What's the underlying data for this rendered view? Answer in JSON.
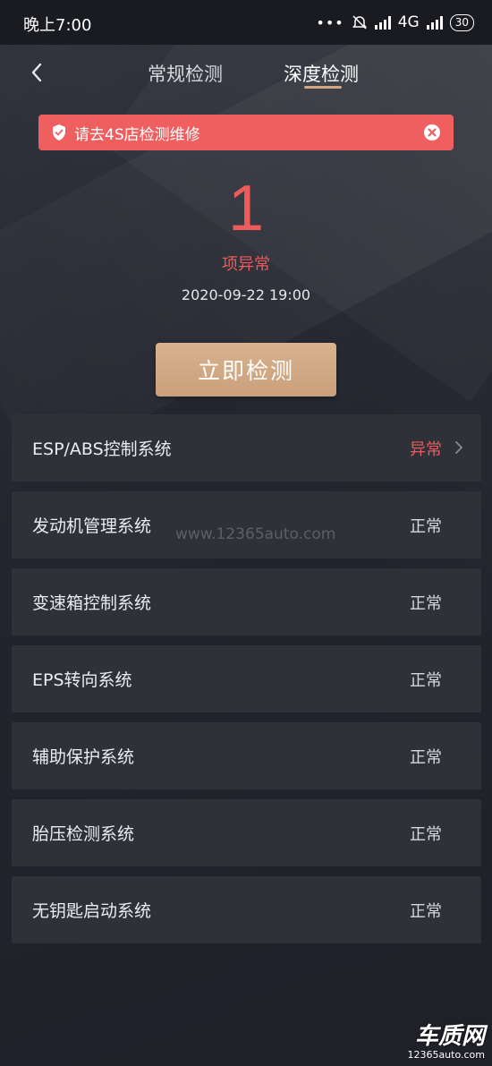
{
  "status_bar": {
    "time": "晚上7:00",
    "network": "4G",
    "battery": "30",
    "dots": "•••"
  },
  "header": {
    "tabs": [
      {
        "label": "常规检测"
      },
      {
        "label": "深度检测"
      }
    ]
  },
  "alert": {
    "message": "请去4S店检测维修"
  },
  "summary": {
    "count": "1",
    "label": "项异常",
    "timestamp": "2020-09-22 19:00"
  },
  "detect_button": {
    "label": "立即检测"
  },
  "watermark": "www.12365auto.com",
  "systems": [
    {
      "name": "ESP/ABS控制系统",
      "status": "异常"
    },
    {
      "name": "发动机管理系统",
      "status": "正常"
    },
    {
      "name": "变速箱控制系统",
      "status": "正常"
    },
    {
      "name": "EPS转向系统",
      "status": "正常"
    },
    {
      "name": "辅助保护系统",
      "status": "正常"
    },
    {
      "name": "胎压检测系统",
      "status": "正常"
    },
    {
      "name": "无钥匙启动系统",
      "status": "正常"
    }
  ],
  "logo": {
    "title": "车质网",
    "url": "12365auto.com"
  },
  "colors": {
    "accent_red": "#ee5b5b",
    "gold": "#d2a882",
    "card": "#2f3139"
  }
}
